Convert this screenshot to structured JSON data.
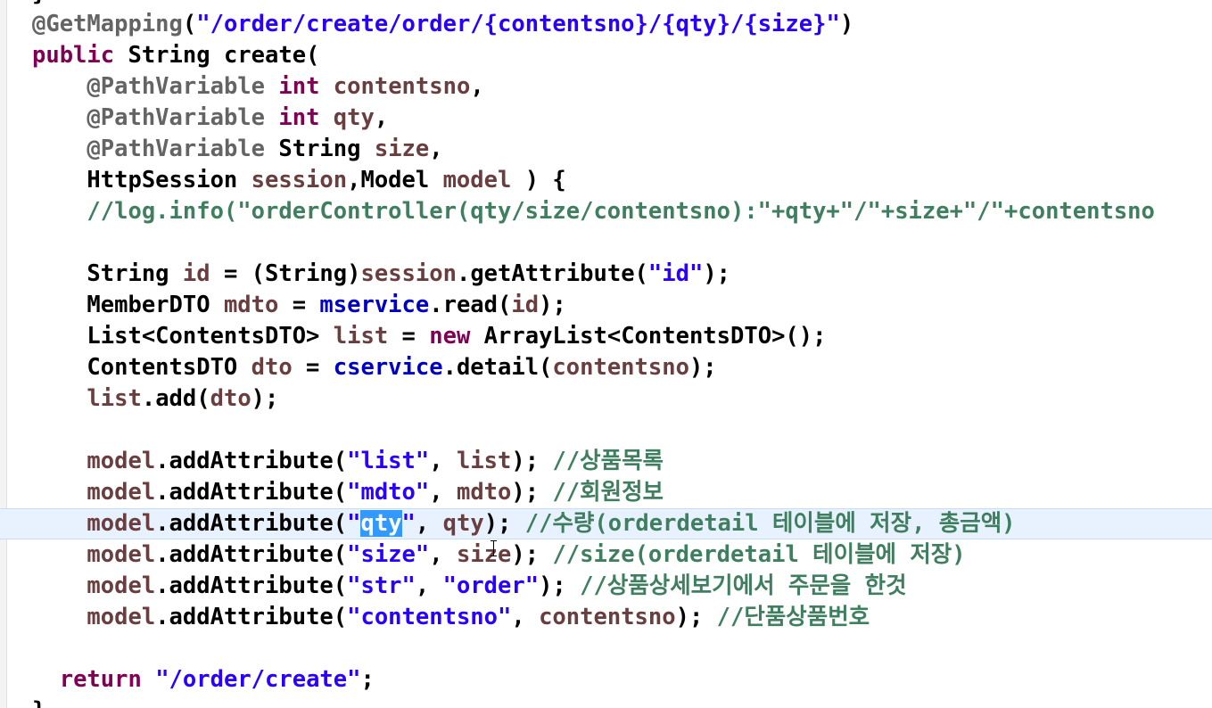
{
  "editor": {
    "lines": [
      {
        "tokens": [
          {
            "t": "}",
            "c": ""
          }
        ]
      },
      {
        "tokens": [
          {
            "t": "@GetMapping",
            "c": "a"
          },
          {
            "t": "(",
            "c": ""
          },
          {
            "t": "\"/order/create/order/{contentsno}/{qty}/{size}\"",
            "c": "s"
          },
          {
            "t": ")",
            "c": ""
          }
        ]
      },
      {
        "tokens": [
          {
            "t": "public",
            "c": "k"
          },
          {
            "t": " String create(",
            "c": ""
          }
        ]
      },
      {
        "tokens": [
          {
            "t": "    ",
            "c": ""
          },
          {
            "t": "@PathVariable",
            "c": "a"
          },
          {
            "t": " ",
            "c": ""
          },
          {
            "t": "int",
            "c": "k"
          },
          {
            "t": " ",
            "c": ""
          },
          {
            "t": "contentsno",
            "c": "v"
          },
          {
            "t": ",",
            "c": ""
          }
        ]
      },
      {
        "tokens": [
          {
            "t": "    ",
            "c": ""
          },
          {
            "t": "@PathVariable",
            "c": "a"
          },
          {
            "t": " ",
            "c": ""
          },
          {
            "t": "int",
            "c": "k"
          },
          {
            "t": " ",
            "c": ""
          },
          {
            "t": "qty",
            "c": "v"
          },
          {
            "t": ",",
            "c": ""
          }
        ]
      },
      {
        "tokens": [
          {
            "t": "    ",
            "c": ""
          },
          {
            "t": "@PathVariable",
            "c": "a"
          },
          {
            "t": " String ",
            "c": ""
          },
          {
            "t": "size",
            "c": "v"
          },
          {
            "t": ",",
            "c": ""
          }
        ]
      },
      {
        "tokens": [
          {
            "t": "    HttpSession ",
            "c": ""
          },
          {
            "t": "session",
            "c": "v"
          },
          {
            "t": ",Model ",
            "c": ""
          },
          {
            "t": "model",
            "c": "v"
          },
          {
            "t": " ) {",
            "c": ""
          }
        ]
      },
      {
        "tokens": [
          {
            "t": "    //log.info(\"orderController(qty/size/contentsno):\"+qty+\"/\"+size+\"/\"+contentsno",
            "c": "c"
          }
        ]
      },
      {
        "tokens": []
      },
      {
        "tokens": [
          {
            "t": "    String ",
            "c": ""
          },
          {
            "t": "id",
            "c": "v"
          },
          {
            "t": " = (String)",
            "c": ""
          },
          {
            "t": "session",
            "c": "v"
          },
          {
            "t": ".getAttribute(",
            "c": ""
          },
          {
            "t": "\"id\"",
            "c": "s"
          },
          {
            "t": ");",
            "c": ""
          }
        ]
      },
      {
        "tokens": [
          {
            "t": "    MemberDTO ",
            "c": ""
          },
          {
            "t": "mdto",
            "c": "v"
          },
          {
            "t": " = ",
            "c": ""
          },
          {
            "t": "mservice",
            "c": "f"
          },
          {
            "t": ".read(",
            "c": ""
          },
          {
            "t": "id",
            "c": "v"
          },
          {
            "t": ");",
            "c": ""
          }
        ]
      },
      {
        "tokens": [
          {
            "t": "    List<ContentsDTO> ",
            "c": ""
          },
          {
            "t": "list",
            "c": "v"
          },
          {
            "t": " = ",
            "c": ""
          },
          {
            "t": "new",
            "c": "k"
          },
          {
            "t": " ArrayList<ContentsDTO>();",
            "c": ""
          }
        ]
      },
      {
        "tokens": [
          {
            "t": "    ContentsDTO ",
            "c": ""
          },
          {
            "t": "dto",
            "c": "v"
          },
          {
            "t": " = ",
            "c": ""
          },
          {
            "t": "cservice",
            "c": "f"
          },
          {
            "t": ".detail(",
            "c": ""
          },
          {
            "t": "contentsno",
            "c": "v"
          },
          {
            "t": ");",
            "c": ""
          }
        ]
      },
      {
        "tokens": [
          {
            "t": "    ",
            "c": ""
          },
          {
            "t": "list",
            "c": "v"
          },
          {
            "t": ".add(",
            "c": ""
          },
          {
            "t": "dto",
            "c": "v"
          },
          {
            "t": ");",
            "c": ""
          }
        ]
      },
      {
        "tokens": []
      },
      {
        "tokens": [
          {
            "t": "    ",
            "c": ""
          },
          {
            "t": "model",
            "c": "v"
          },
          {
            "t": ".addAttribute(",
            "c": ""
          },
          {
            "t": "\"list\"",
            "c": "s"
          },
          {
            "t": ", ",
            "c": ""
          },
          {
            "t": "list",
            "c": "v"
          },
          {
            "t": "); ",
            "c": ""
          },
          {
            "t": "//상품목록",
            "c": "c"
          }
        ]
      },
      {
        "tokens": [
          {
            "t": "    ",
            "c": ""
          },
          {
            "t": "model",
            "c": "v"
          },
          {
            "t": ".addAttribute(",
            "c": ""
          },
          {
            "t": "\"mdto\"",
            "c": "s"
          },
          {
            "t": ", ",
            "c": ""
          },
          {
            "t": "mdto",
            "c": "v"
          },
          {
            "t": "); ",
            "c": ""
          },
          {
            "t": "//회원정보",
            "c": "c"
          }
        ]
      },
      {
        "current": true,
        "tokens": [
          {
            "t": "    ",
            "c": ""
          },
          {
            "t": "model",
            "c": "v"
          },
          {
            "t": ".addAttribute(",
            "c": ""
          },
          {
            "t": "\"",
            "c": "s"
          },
          {
            "t": "qty",
            "c": "sel"
          },
          {
            "t": "\"",
            "c": "s"
          },
          {
            "t": ", ",
            "c": ""
          },
          {
            "t": "qty",
            "c": "v"
          },
          {
            "t": "); ",
            "c": ""
          },
          {
            "t": "//수량(orderdetail 테이블에 저장, 총금액)",
            "c": "c"
          }
        ]
      },
      {
        "tokens": [
          {
            "t": "    ",
            "c": ""
          },
          {
            "t": "model",
            "c": "v"
          },
          {
            "t": ".addAttribute(",
            "c": ""
          },
          {
            "t": "\"size\"",
            "c": "s"
          },
          {
            "t": ", ",
            "c": ""
          },
          {
            "t": "size",
            "c": "v"
          },
          {
            "t": "); ",
            "c": ""
          },
          {
            "t": "//size(orderdetail 테이블에 저장)",
            "c": "c"
          }
        ]
      },
      {
        "tokens": [
          {
            "t": "    ",
            "c": ""
          },
          {
            "t": "model",
            "c": "v"
          },
          {
            "t": ".addAttribute(",
            "c": ""
          },
          {
            "t": "\"str\"",
            "c": "s"
          },
          {
            "t": ", ",
            "c": ""
          },
          {
            "t": "\"order\"",
            "c": "s"
          },
          {
            "t": "); ",
            "c": ""
          },
          {
            "t": "//상품상세보기에서 주문을 한것",
            "c": "c"
          }
        ]
      },
      {
        "tokens": [
          {
            "t": "    ",
            "c": ""
          },
          {
            "t": "model",
            "c": "v"
          },
          {
            "t": ".addAttribute(",
            "c": ""
          },
          {
            "t": "\"contentsno\"",
            "c": "s"
          },
          {
            "t": ", ",
            "c": ""
          },
          {
            "t": "contentsno",
            "c": "v"
          },
          {
            "t": "); ",
            "c": ""
          },
          {
            "t": "//단품상품번호",
            "c": "c"
          }
        ]
      },
      {
        "tokens": []
      },
      {
        "tokens": [
          {
            "t": "  ",
            "c": ""
          },
          {
            "t": "return",
            "c": "k"
          },
          {
            "t": " ",
            "c": ""
          },
          {
            "t": "\"/order/create\"",
            "c": "s"
          },
          {
            "t": ";",
            "c": ""
          }
        ]
      },
      {
        "tokens": [
          {
            "t": "}",
            "c": ""
          }
        ]
      }
    ]
  }
}
